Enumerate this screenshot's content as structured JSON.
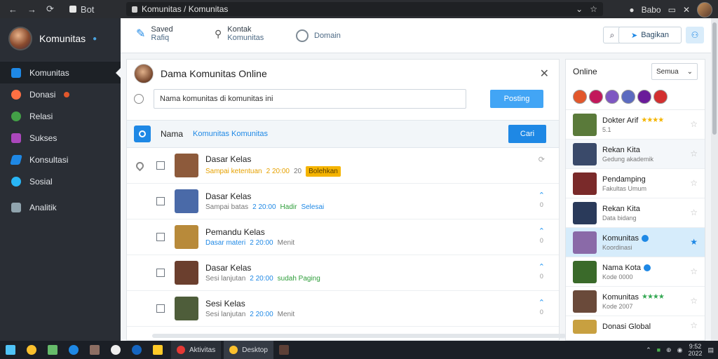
{
  "browser": {
    "tab_title": "Bot",
    "address": "Komunitas / Komunitas",
    "right_label": "Babo"
  },
  "sidebar": {
    "brand": "Komunitas",
    "items": [
      {
        "label": "Komunitas",
        "color": "#1e88e5"
      },
      {
        "label": "Donasi",
        "color": "#ff7043"
      },
      {
        "label": "Relasi",
        "color": "#43a047"
      },
      {
        "label": "Sukses",
        "color": "#ab47bc"
      },
      {
        "label": "Konsultasi",
        "color": "#1e88e5"
      },
      {
        "label": "Sosial",
        "color": "#29b6f6"
      },
      {
        "label": "Analitik",
        "color": "#90a4ae"
      }
    ]
  },
  "topbar": {
    "item1_title": "Saved",
    "item1_sub": "Rafiq",
    "item2_title": "Kontak",
    "item2_sub": "Komunitas",
    "item3_title": "Domain",
    "share_label": "Bagikan"
  },
  "post": {
    "title": "Dama Komunitas Online",
    "composer_value": "Nama komunitas di komunitas ini",
    "post_button": "Posting",
    "filter_label": "Nama",
    "filter_value": "Komunitas Komunitas",
    "filter_button": "Cari"
  },
  "rows": [
    {
      "name": "Dasar Kelas",
      "meta1": "Sampai ketentuan",
      "meta2": "2 20:00",
      "meta3": "20",
      "tag": "Bolehkan",
      "thumb": "#8d5a3b"
    },
    {
      "name": "Dasar Kelas",
      "meta1": "Sampai batas",
      "meta2": "2 20:00",
      "meta3": "Hadir",
      "extra": "Selesai",
      "thumb": "#4a6aa8",
      "count": "0"
    },
    {
      "name": "Pemandu Kelas",
      "meta1": "Dasar materi",
      "meta2": "2 20:00",
      "meta3": "Menit",
      "thumb": "#b88a3a",
      "count": "0"
    },
    {
      "name": "Dasar Kelas",
      "meta1": "Sesi lanjutan",
      "meta2": "2 20:00",
      "meta3": "sudah Paging",
      "thumb": "#6b3f2e",
      "count": "0"
    },
    {
      "name": "Sesi Kelas",
      "meta1": "Sesi lanjutan",
      "meta2": "2 20:00",
      "meta3": "Menit",
      "thumb": "#4e5d3a",
      "count": "0"
    }
  ],
  "online": {
    "title": "Online",
    "select_value": "Semua",
    "avatar_colors": [
      "#e2572b",
      "#c2185b",
      "#7e57c2",
      "#5c6bc0",
      "#6a1b9a",
      "#d32f2f"
    ],
    "items": [
      {
        "name": "Dokter Arif",
        "sub": "5.1",
        "stars": "★★★★",
        "thumb": "#5a7a3a"
      },
      {
        "name": "Rekan Kita",
        "sub": "Gedung akademik",
        "thumb": "#3a4a6a"
      },
      {
        "name": "Pendamping",
        "sub": "Fakultas Umum",
        "thumb": "#7a2a2a"
      },
      {
        "name": "Rekan Kita",
        "sub": "Data bidang",
        "thumb": "#2a3a5a"
      },
      {
        "name": "Komunitas",
        "sub": "Koordinasi",
        "thumb": "#8a6aa8",
        "selected": true
      },
      {
        "name": "Nama Kota",
        "sub": "Kode 0000",
        "thumb": "#3a6a2a"
      },
      {
        "name": "Komunitas",
        "sub": "Kode 2007",
        "stars": "★★★★",
        "thumb": "#6a4a3a"
      },
      {
        "name": "Donasi Global",
        "sub": "",
        "thumb": "#c8a040"
      }
    ]
  },
  "taskbar": {
    "app1": "Aktivitas",
    "app2": "Desktop",
    "clock_time": "9:52",
    "clock_date": "2022"
  }
}
